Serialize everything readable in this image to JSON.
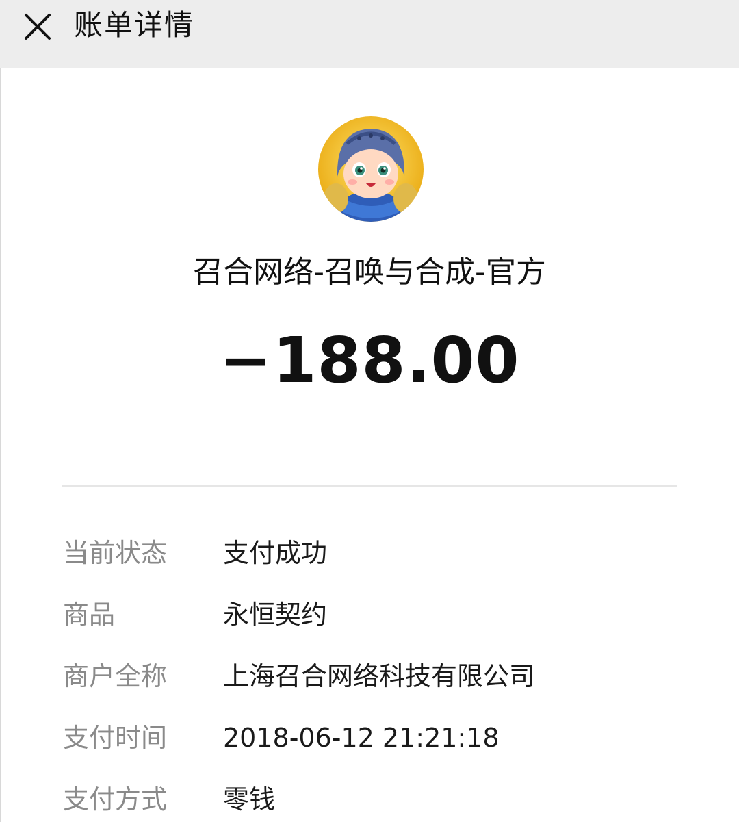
{
  "header": {
    "title": "账单详情",
    "close_icon": "close-icon"
  },
  "merchant": {
    "avatar": "game-character-avatar",
    "name": "召合网络-召唤与合成-官方"
  },
  "amount": "−188.00",
  "details": [
    {
      "label": "当前状态",
      "value": "支付成功"
    },
    {
      "label": "商品",
      "value": "永恒契约"
    },
    {
      "label": "商户全称",
      "value": "上海召合网络科技有限公司"
    },
    {
      "label": "支付时间",
      "value": "2018-06-12 21:21:18"
    },
    {
      "label": "支付方式",
      "value": "零钱"
    }
  ],
  "colors": {
    "header_bg": "#ededed",
    "label_gray": "#8a8a8a",
    "text_dark": "#111111"
  }
}
